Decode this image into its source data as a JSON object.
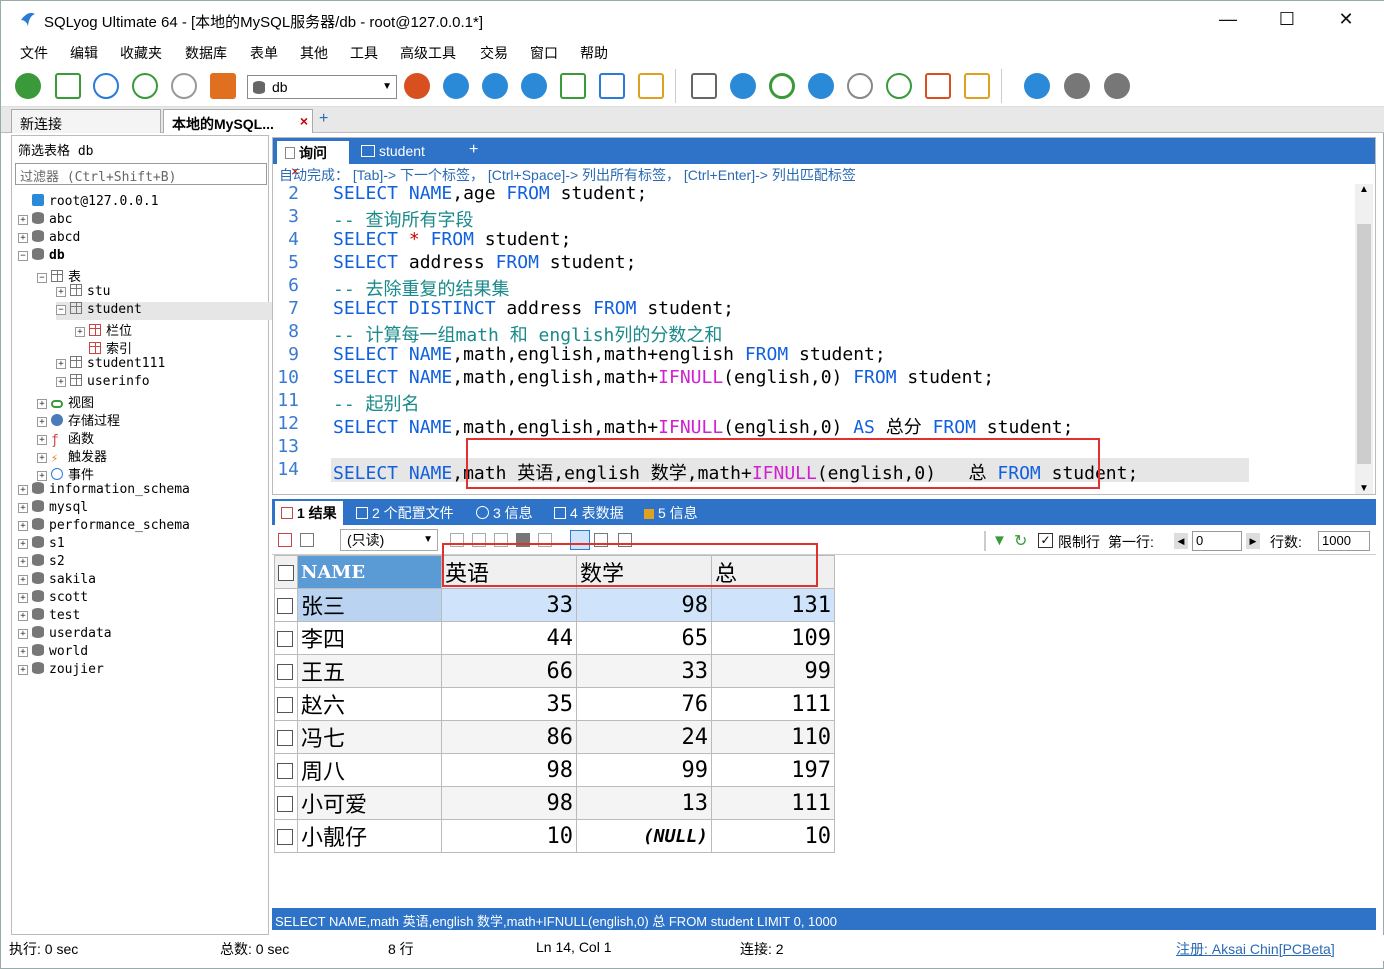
{
  "window": {
    "title": "SQLyog Ultimate 64 - [本地的MySQL服务器/db - root@127.0.0.1*]",
    "minimize": "—",
    "maximize": "☐",
    "close": "✕"
  },
  "menu": [
    "文件",
    "编辑",
    "收藏夹",
    "数据库",
    "表单",
    "其他",
    "工具",
    "高级工具",
    "交易",
    "窗口",
    "帮助"
  ],
  "toolbar": {
    "db_select": "db"
  },
  "conn_tabs": {
    "new": "新连接",
    "active": "本地的MySQL...",
    "close": "×",
    "add": "+"
  },
  "left": {
    "filter_title": "筛选表格 db",
    "filter_placeholder": "过滤器 (Ctrl+Shift+B)",
    "tree": [
      {
        "label": "root@127.0.0.1",
        "pm": "",
        "icon": "server"
      },
      {
        "label": "abc",
        "pm": "+",
        "icon": "db"
      },
      {
        "label": "abcd",
        "pm": "+",
        "icon": "db"
      },
      {
        "label": "db",
        "pm": "−",
        "icon": "db"
      },
      {
        "label": "表",
        "pm": "−",
        "icon": "tbl"
      },
      {
        "label": "stu",
        "pm": "+",
        "icon": "tbl"
      },
      {
        "label": "student",
        "pm": "−",
        "icon": "tbl"
      },
      {
        "label": "栏位",
        "pm": "+",
        "icon": "red"
      },
      {
        "label": "索引",
        "pm": "",
        "icon": "red"
      },
      {
        "label": "student111",
        "pm": "+",
        "icon": "tbl"
      },
      {
        "label": "userinfo",
        "pm": "+",
        "icon": "tbl"
      },
      {
        "label": "视图",
        "pm": "+",
        "icon": "view"
      },
      {
        "label": "存储过程",
        "pm": "+",
        "icon": "gear"
      },
      {
        "label": "函数",
        "pm": "+",
        "icon": "fx"
      },
      {
        "label": "触发器",
        "pm": "+",
        "icon": "bolt"
      },
      {
        "label": "事件",
        "pm": "+",
        "icon": "clock"
      },
      {
        "label": "information_schema",
        "pm": "+",
        "icon": "db"
      },
      {
        "label": "mysql",
        "pm": "+",
        "icon": "db"
      },
      {
        "label": "performance_schema",
        "pm": "+",
        "icon": "db"
      },
      {
        "label": "s1",
        "pm": "+",
        "icon": "db"
      },
      {
        "label": "s2",
        "pm": "+",
        "icon": "db"
      },
      {
        "label": "sakila",
        "pm": "+",
        "icon": "db"
      },
      {
        "label": "scott",
        "pm": "+",
        "icon": "db"
      },
      {
        "label": "test",
        "pm": "+",
        "icon": "db"
      },
      {
        "label": "userdata",
        "pm": "+",
        "icon": "db"
      },
      {
        "label": "world",
        "pm": "+",
        "icon": "db"
      },
      {
        "label": "zoujier",
        "pm": "+",
        "icon": "db"
      }
    ]
  },
  "editor": {
    "tab_query": "询问",
    "tab_query_close": "×",
    "tab_student": "student",
    "tab_add": "+",
    "hint": "自动完成： [Tab]-> 下一个标签， [Ctrl+Space]-> 列出所有标签， [Ctrl+Enter]-> 列出匹配标签",
    "line_numbers": [
      "2",
      "3",
      "4",
      "5",
      "6",
      "7",
      "8",
      "9",
      "10",
      "11",
      "12",
      "13",
      "14"
    ]
  },
  "results": {
    "tabs": [
      "1 结果",
      "2 个配置文件",
      "3 信息",
      "4 表数据",
      "5 信息"
    ],
    "readonly": "(只读)",
    "limit_label": "限制行",
    "first_row_label": "第一行:",
    "first_row_value": "0",
    "rows_label": "行数:",
    "rows_value": "1000",
    "columns": [
      "NAME",
      "英语",
      "数学",
      "总"
    ],
    "rows": [
      [
        "张三",
        "33",
        "98",
        "131"
      ],
      [
        "李四",
        "44",
        "65",
        "109"
      ],
      [
        "王五",
        "66",
        "33",
        "99"
      ],
      [
        "赵六",
        "35",
        "76",
        "111"
      ],
      [
        "冯七",
        "86",
        "24",
        "110"
      ],
      [
        "周八",
        "98",
        "99",
        "197"
      ],
      [
        "小可爱",
        "98",
        "13",
        "111"
      ],
      [
        "小靓仔",
        "10",
        "(NULL)",
        "10"
      ]
    ]
  },
  "query_status": "SELECT NAME,math 英语,english 数学,math+IFNULL(english,0) 总 FROM student LIMIT 0, 1000",
  "statusbar": {
    "exec": "执行: 0 sec",
    "total": "总数: 0 sec",
    "rows": "8 行",
    "pos": "Ln 14, Col 1",
    "conn": "连接: 2",
    "reg": "注册: Aksai Chin[PCBeta]"
  },
  "colors": {
    "accent_blue": "#2e73c8",
    "keyword": "#1060e0",
    "function": "#d020d0",
    "comment": "#1a8a8a",
    "highlight_box": "#e03030"
  }
}
